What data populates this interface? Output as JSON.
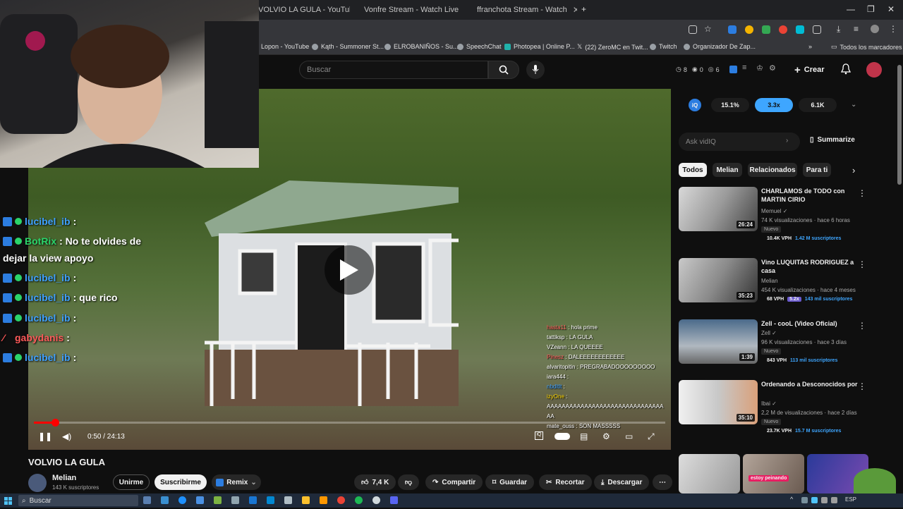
{
  "browser": {
    "tabs": [
      {
        "label": "VOLVIO LA GULA - YouTube"
      },
      {
        "label": "Vonfre Stream - Watch Live"
      },
      {
        "label": "ffranchota Stream - Watch"
      }
    ],
    "bookmarks": [
      "Lopon - YouTube",
      "Kąth - Summoner St...",
      "ELROBANIÑOS - Su...",
      "SpeechChat",
      "Photopea | Online P...",
      "(22) ZeroMC en Twit...",
      "Twitch",
      "Organizador De Zap..."
    ],
    "all_bookmarks": "Todos los marcadores"
  },
  "masthead": {
    "search_placeholder": "Buscar",
    "stats": [
      "8",
      "0",
      "6"
    ],
    "create_label": "Crear"
  },
  "player": {
    "time": "0:50 / 24:13",
    "progress_fraction": 0.034,
    "chat_left": [
      {
        "user": "lucibel_ib",
        "msg": ":",
        "color": "#3fa0ff"
      },
      {
        "user": "BotRix",
        "msg": ": No te olvides de",
        "color": "#2bd46a"
      },
      {
        "user": "",
        "msg": "dejar la view apoyo",
        "color": "#ffffff"
      },
      {
        "user": "lucibel_ib",
        "msg": ":",
        "color": "#3fa0ff"
      },
      {
        "user": "lucibel_ib",
        "msg": ": que rico",
        "color": "#3fa0ff"
      },
      {
        "user": "lucibel_ib",
        "msg": ":",
        "color": "#3fa0ff"
      },
      {
        "user": "gabydanis",
        "msg": ":",
        "color": "#ff5a5a"
      },
      {
        "user": "lucibel_ib",
        "msg": ":",
        "color": "#3fa0ff"
      }
    ],
    "chat_right": [
      {
        "user": "hasta11",
        "msg": ": hola prime",
        "color": "#ff5a5a"
      },
      {
        "user": "tattiksp",
        "msg": ": LA GULA",
        "color": "#ffffff"
      },
      {
        "user": "VZeann",
        "msg": ": LA QUEEEE",
        "color": "#ffffff"
      },
      {
        "user": "Pinesz",
        "msg": ": DALEEEEEEEEEEEE",
        "color": "#ff5a5a"
      },
      {
        "user": "alvaritopitin",
        "msg": ": PREGRABADOOOOOOOOO",
        "color": "#ffffff"
      },
      {
        "user": "iara444",
        "msg": ":",
        "color": "#ffffff"
      },
      {
        "user": "nbdltlt",
        "msg": ":",
        "color": "#3fa0ff"
      },
      {
        "user": "izyOne",
        "msg": ":",
        "color": "#ffd700"
      },
      {
        "user": "",
        "msg": "AAAAAAAAAAAAAAAAAAAAAAAAAAAAAAA",
        "color": "#ffffff"
      },
      {
        "user": "",
        "msg": "AA",
        "color": "#ffffff"
      },
      {
        "user": "mate_ouss",
        "msg": ": SON  MASSSSS",
        "color": "#ffffff"
      }
    ]
  },
  "video": {
    "title": "VOLVIO LA GULA",
    "channel": "Melian",
    "subscribers": "143 K suscriptores",
    "join_label": "Unirme",
    "subscribe_label": "Suscribirme",
    "remix_label": "Remix",
    "likes": "7,4 K",
    "share_label": "Compartir",
    "save_label": "Guardar",
    "clip_label": "Recortar",
    "download_label": "Descargar"
  },
  "sidebar": {
    "iq_stats": [
      "15.1%",
      "3.3x",
      "6.1K"
    ],
    "ask_placeholder": "Ask vidIQ",
    "summarize_label": "Summarize",
    "chips": [
      "Todos",
      "Melian",
      "Relacionados",
      "Para ti"
    ],
    "recommendations": [
      {
        "title": "CHARLAMOS de TODO con MARTIN CIRIO",
        "channel": "Memuel",
        "meta": "74 K visualizaciones · hace 6 horas",
        "tag": "Nuevo",
        "duration": "26:24",
        "vph": "10.4K VPH",
        "subs": "1.42 M suscriptores"
      },
      {
        "title": "Vino LUQUITAS RODRIGUEZ a casa",
        "channel": "Melian",
        "meta": "454 K visualizaciones · hace 4 meses",
        "tag": "",
        "duration": "35:23",
        "vph": "68 VPH",
        "mult": "5.2x",
        "subs": "143 mil suscriptores"
      },
      {
        "title": "Zell - cooL (Video Oficial)",
        "channel": "Zell",
        "meta": "96 K visualizaciones · hace 3 días",
        "tag": "Nuevo",
        "duration": "1:39",
        "vph": "843 VPH",
        "subs": "113 mil suscriptores"
      },
      {
        "title": "Ordenando a Desconocidos por",
        "channel": "Ibai",
        "meta": "2,2 M de visualizaciones · hace 2 días",
        "tag": "Nuevo",
        "duration": "35:10",
        "vph": "23.7K VPH",
        "subs": "15.7 M suscriptores"
      }
    ],
    "shorts_caption": "estoy peinando"
  },
  "taskbar": {
    "search_label": "Buscar",
    "locale": "ESP"
  }
}
